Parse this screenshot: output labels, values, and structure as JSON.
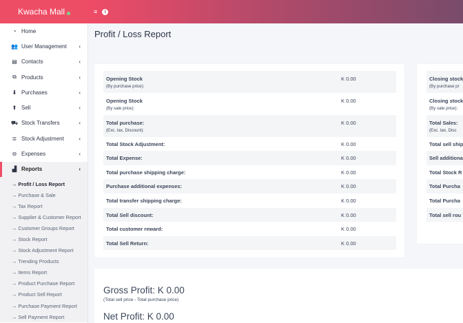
{
  "brand": {
    "name": "Kwacha Mall"
  },
  "topbar": {
    "menu_icon": "≡",
    "info_icon": "i"
  },
  "sidebar": {
    "items": [
      {
        "label": "Home",
        "icon": "dashboard-icon",
        "glyph": "◔",
        "chevron": false
      },
      {
        "label": "User Management",
        "icon": "users-icon",
        "glyph": "👥",
        "chevron": true
      },
      {
        "label": "Contacts",
        "icon": "address-book-icon",
        "glyph": "▤",
        "chevron": true
      },
      {
        "label": "Products",
        "icon": "cubes-icon",
        "glyph": "⧉",
        "chevron": true
      },
      {
        "label": "Purchases",
        "icon": "arrow-circle-down-icon",
        "glyph": "⬇",
        "chevron": true
      },
      {
        "label": "Sell",
        "icon": "arrow-circle-up-icon",
        "glyph": "⬆",
        "chevron": true
      },
      {
        "label": "Stock Transfers",
        "icon": "truck-icon",
        "glyph": "⛟",
        "chevron": true
      },
      {
        "label": "Stock Adjustment",
        "icon": "database-icon",
        "glyph": "≣",
        "chevron": true
      },
      {
        "label": "Expenses",
        "icon": "minus-circle-icon",
        "glyph": "⊖",
        "chevron": true
      },
      {
        "label": "Reports",
        "icon": "bar-chart-icon",
        "glyph": "▟",
        "chevron": true
      }
    ],
    "submenu": [
      "→ Profit / Loss Report",
      "→ Purchase & Sale",
      "→ Tax Report",
      "→ Supplier & Customer Report",
      "→ Customer Groups Report",
      "→ Stock Report",
      "→ Stock Adjustment Report",
      "→ Trending Products",
      "→ Items Report",
      "→ Product Purchase Report",
      "→ Product Sell Report",
      "→ Purchase Payment Report",
      "→ Sell Payment Report"
    ]
  },
  "page": {
    "title": "Profit / Loss Report"
  },
  "left_table": [
    {
      "label": "Opening Stock",
      "sub": "(By purchase price):",
      "value": "K 0.00"
    },
    {
      "label": "Opening Stock",
      "sub": "(By sale price):",
      "value": "K 0.00"
    },
    {
      "label": "Total purchase:",
      "sub": "(Exc. tax, Discount)",
      "value": "K 0.00"
    },
    {
      "label": "Total Stock Adjustment:",
      "sub": "",
      "value": "K 0.00"
    },
    {
      "label": "Total Expense:",
      "sub": "",
      "value": "K 0.00"
    },
    {
      "label": "Total purchase shipping charge:",
      "sub": "",
      "value": "K 0.00"
    },
    {
      "label": "Purchase additional expenses:",
      "sub": "",
      "value": "K 0.00"
    },
    {
      "label": "Total transfer shipping charge:",
      "sub": "",
      "value": "K 0.00"
    },
    {
      "label": "Total Sell discount:",
      "sub": "",
      "value": "K 0.00"
    },
    {
      "label": "Total customer reward:",
      "sub": "",
      "value": "K 0.00"
    },
    {
      "label": "Total Sell Return:",
      "sub": "",
      "value": "K 0.00"
    }
  ],
  "right_table": [
    {
      "label": "Closing stock",
      "sub": "(By purchase pr"
    },
    {
      "label": "Closing stock",
      "sub": "(By sale price):"
    },
    {
      "label": "Total Sales:",
      "sub": "(Exc. tax, Disc"
    },
    {
      "label": "Total sell ship",
      "sub": ""
    },
    {
      "label": "Sell additiona",
      "sub": ""
    },
    {
      "label": "Total Stock R",
      "sub": ""
    },
    {
      "label": "Total Purcha",
      "sub": ""
    },
    {
      "label": "Total Purcha",
      "sub": ""
    },
    {
      "label": "Total sell rou",
      "sub": ""
    }
  ],
  "summary": {
    "gross_profit": "Gross Profit: K 0.00",
    "gross_note": "(Total sell price - Total purchase price)",
    "net_profit": "Net Profit: K 0.00"
  }
}
